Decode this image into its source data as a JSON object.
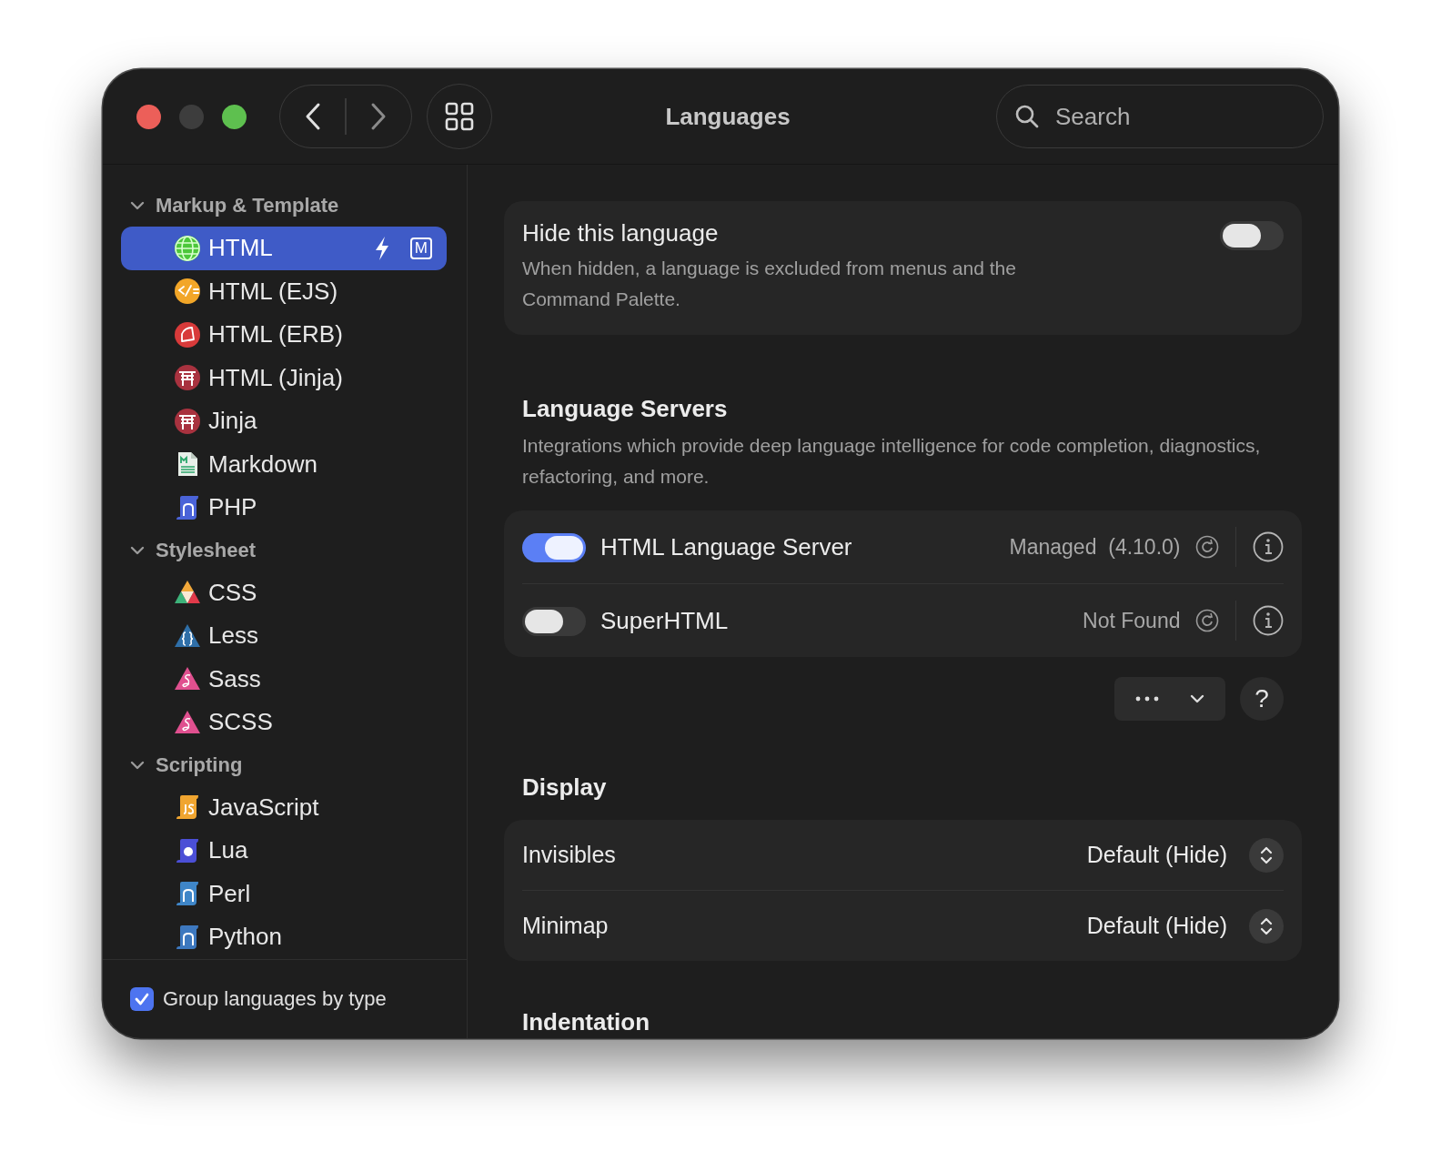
{
  "window": {
    "title": "Languages"
  },
  "search": {
    "placeholder": "Search"
  },
  "sidebar": {
    "groups": [
      {
        "label": "Markup & Template",
        "expanded": true,
        "items": [
          {
            "label": "HTML",
            "selected": true,
            "badge": "M"
          },
          {
            "label": "HTML (EJS)",
            "selected": false
          },
          {
            "label": "HTML (ERB)",
            "selected": false
          },
          {
            "label": "HTML (Jinja)",
            "selected": false
          },
          {
            "label": "Jinja",
            "selected": false
          },
          {
            "label": "Markdown",
            "selected": false
          },
          {
            "label": "PHP",
            "selected": false
          }
        ]
      },
      {
        "label": "Stylesheet",
        "expanded": true,
        "items": [
          {
            "label": "CSS",
            "selected": false
          },
          {
            "label": "Less",
            "selected": false
          },
          {
            "label": "Sass",
            "selected": false
          },
          {
            "label": "SCSS",
            "selected": false
          }
        ]
      },
      {
        "label": "Scripting",
        "expanded": true,
        "items": [
          {
            "label": "JavaScript",
            "selected": false
          },
          {
            "label": "Lua",
            "selected": false
          },
          {
            "label": "Perl",
            "selected": false
          },
          {
            "label": "Python",
            "selected": false
          }
        ]
      }
    ],
    "footer": {
      "label": "Group languages by type",
      "checked": true
    }
  },
  "hide_language": {
    "title": "Hide this language",
    "description": "When hidden, a language is excluded from menus and the Command Palette.",
    "on": false
  },
  "language_servers": {
    "heading": "Language Servers",
    "description": "Integrations which provide deep language intelligence for code completion, diagnostics, refactoring, and more.",
    "servers": [
      {
        "name": "HTML Language Server",
        "on": true,
        "status": "Managed  (4.10.0)"
      },
      {
        "name": "SuperHTML",
        "on": false,
        "status": "Not Found"
      }
    ],
    "help_button": "?"
  },
  "display": {
    "heading": "Display",
    "settings": [
      {
        "label": "Invisibles",
        "value": "Default (Hide)"
      },
      {
        "label": "Minimap",
        "value": "Default (Hide)"
      }
    ]
  },
  "next_section": {
    "heading": "Indentation"
  }
}
